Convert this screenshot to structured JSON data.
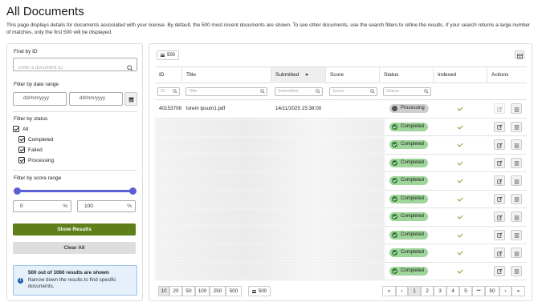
{
  "page": {
    "title": "All Documents",
    "description": "This page displays details for documents associated with your license. By default, the 500 most recent documents are shown. To see other documents, use the search filters to refine the results. If your search returns a large number of matches, only the first 500 will be displayed."
  },
  "sidebar": {
    "find_label": "Find by ID",
    "find_placeholder": "Enter a document ID",
    "date_label": "Filter by date range",
    "date_from": "dd/mm/yyyy",
    "date_to": "dd/mm/yyyy",
    "status_label": "Filter by status",
    "status_options": [
      "All",
      "Completed",
      "Failed",
      "Processing"
    ],
    "score_label": "Filter by score range",
    "score_min": "0",
    "score_max": "100",
    "score_unit": "%",
    "score_range": [
      0,
      100
    ],
    "show_button": "Show Results",
    "clear_button": "Clear All",
    "info_title": "500 out of 1060 results are shown",
    "info_text": "Narrow down the results to find specific documents."
  },
  "toolbar": {
    "page_size_chip": "500"
  },
  "table": {
    "columns": [
      "ID",
      "Title",
      "Submitted",
      "Score",
      "Status",
      "Indexed",
      "Actions"
    ],
    "filter_placeholders": [
      "ID",
      "Title",
      "Submitted",
      "Score",
      "Status"
    ],
    "rows": [
      {
        "id": "40153706",
        "title": "lorem ipsum1.pdf",
        "submitted": "14/11/2025 15:38:00",
        "score": "",
        "status": "Processing",
        "indexed": true
      },
      {
        "id": "",
        "title": "",
        "submitted": "",
        "score": "",
        "status": "Completed",
        "indexed": true
      },
      {
        "id": "",
        "title": "",
        "submitted": "",
        "score": "",
        "status": "Completed",
        "indexed": true
      },
      {
        "id": "",
        "title": "",
        "submitted": "",
        "score": "",
        "status": "Completed",
        "indexed": true
      },
      {
        "id": "",
        "title": "",
        "submitted": "",
        "score": "",
        "status": "Completed",
        "indexed": true
      },
      {
        "id": "",
        "title": "",
        "submitted": "",
        "score": "",
        "status": "Completed",
        "indexed": true
      },
      {
        "id": "",
        "title": "",
        "submitted": "",
        "score": "",
        "status": "Completed",
        "indexed": true
      },
      {
        "id": "",
        "title": "",
        "submitted": "",
        "score": "",
        "status": "Completed",
        "indexed": true
      },
      {
        "id": "",
        "title": "",
        "submitted": "",
        "score": "",
        "status": "Completed",
        "indexed": true
      },
      {
        "id": "",
        "title": "",
        "submitted": "",
        "score": "",
        "status": "Completed",
        "indexed": true
      }
    ]
  },
  "footer": {
    "page_sizes": [
      "10",
      "20",
      "50",
      "100",
      "250",
      "500"
    ],
    "selected_page_size": "10",
    "size_chip": "500",
    "pages": [
      "«",
      "‹",
      "1",
      "2",
      "3",
      "4",
      "5",
      "•••",
      "50",
      "›",
      "»"
    ],
    "current_page": "1"
  },
  "colors": {
    "accent": "#5b5fd3",
    "primary_button": "#5f7f1a",
    "completed_badge": "#9fd49a",
    "processing_badge": "#cfcfcf",
    "info_bg": "#e6f0fb"
  }
}
